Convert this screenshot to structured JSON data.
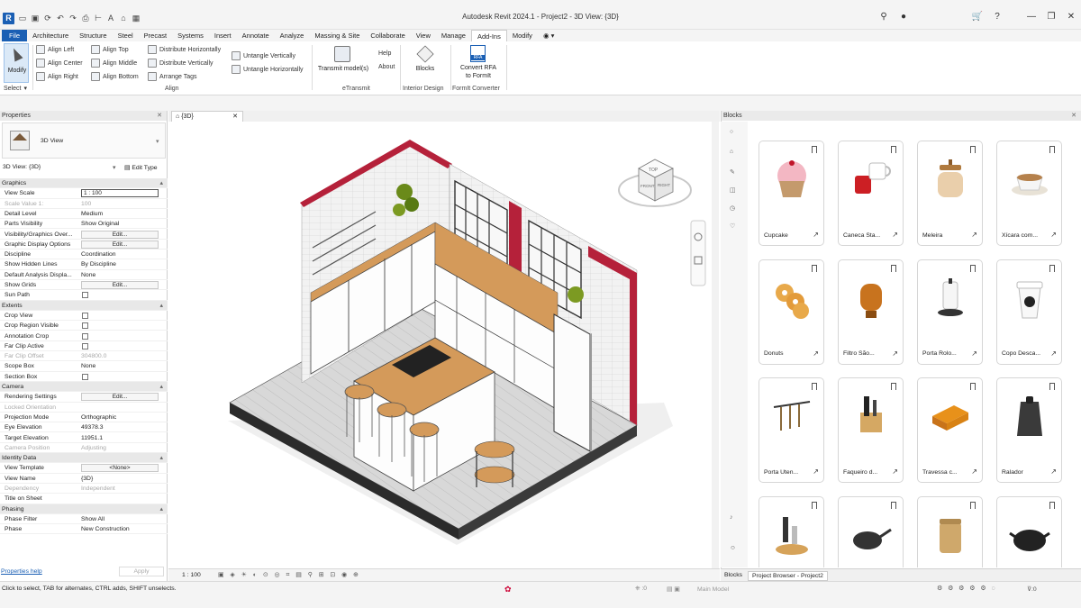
{
  "app": {
    "title": "Autodesk Revit 2024.1 - Project2 - 3D View: {3D}",
    "logo": "R"
  },
  "menu_tabs": [
    "File",
    "Architecture",
    "Structure",
    "Steel",
    "Precast",
    "Systems",
    "Insert",
    "Annotate",
    "Analyze",
    "Massing & Site",
    "Collaborate",
    "View",
    "Manage",
    "Add-Ins",
    "Modify"
  ],
  "ribbon": {
    "modify": "Modify",
    "select": "Select",
    "align": {
      "left": "Align Left",
      "center": "Align Center",
      "right": "Align Right",
      "top": "Align Top",
      "middle": "Align Middle",
      "bottom": "Align Bottom",
      "dist_h": "Distribute Horizontally",
      "dist_v": "Distribute Vertically",
      "arrange": "Arrange Tags",
      "untangle_v": "Untangle Vertically",
      "untangle_h": "Untangle Horizontally",
      "panel": "Align"
    },
    "etransmit": {
      "btn": "Transmit model(s)",
      "panel": "eTransmit"
    },
    "help": "Help",
    "about": "About",
    "blocks": {
      "btn": "Blocks",
      "panel": "Interior Design"
    },
    "formit": {
      "btn1": "Convert RFA",
      "btn2": "to FormIt",
      "panel": "FormIt Converter",
      "badge": "RFA"
    }
  },
  "properties": {
    "title": "Properties",
    "type": "3D View",
    "selector": "3D View: {3D}",
    "edit_type": "Edit Type",
    "help_link": "Properties help",
    "apply": "Apply",
    "rows": [
      {
        "k": "grp",
        "n": "Graphics"
      },
      {
        "k": "box",
        "n": "View Scale",
        "v": "1 : 100"
      },
      {
        "k": "dis",
        "n": "Scale Value    1:",
        "v": "100"
      },
      {
        "k": "txt",
        "n": "Detail Level",
        "v": "Medium"
      },
      {
        "k": "txt",
        "n": "Parts Visibility",
        "v": "Show Original"
      },
      {
        "k": "btn",
        "n": "Visibility/Graphics Over...",
        "v": "Edit..."
      },
      {
        "k": "btn",
        "n": "Graphic Display Options",
        "v": "Edit..."
      },
      {
        "k": "txt",
        "n": "Discipline",
        "v": "Coordination"
      },
      {
        "k": "txt",
        "n": "Show Hidden Lines",
        "v": "By Discipline"
      },
      {
        "k": "txt",
        "n": "Default Analysis Displa...",
        "v": "None"
      },
      {
        "k": "btn",
        "n": "Show Grids",
        "v": "Edit..."
      },
      {
        "k": "cb",
        "n": "Sun Path"
      },
      {
        "k": "grp",
        "n": "Extents"
      },
      {
        "k": "cb",
        "n": "Crop View"
      },
      {
        "k": "cb",
        "n": "Crop Region Visible"
      },
      {
        "k": "cb",
        "n": "Annotation Crop"
      },
      {
        "k": "cb",
        "n": "Far Clip Active"
      },
      {
        "k": "dis",
        "n": "Far Clip Offset",
        "v": "304800.0"
      },
      {
        "k": "txt",
        "n": "Scope Box",
        "v": "None"
      },
      {
        "k": "cb",
        "n": "Section Box"
      },
      {
        "k": "grp",
        "n": "Camera"
      },
      {
        "k": "btn",
        "n": "Rendering Settings",
        "v": "Edit..."
      },
      {
        "k": "dis",
        "n": "Locked Orientation",
        "v": ""
      },
      {
        "k": "txt",
        "n": "Projection Mode",
        "v": "Orthographic"
      },
      {
        "k": "txt",
        "n": "Eye Elevation",
        "v": "49378.3"
      },
      {
        "k": "txt",
        "n": "Target Elevation",
        "v": "11951.1"
      },
      {
        "k": "dis",
        "n": "Camera Position",
        "v": "Adjusting"
      },
      {
        "k": "grp",
        "n": "Identity Data"
      },
      {
        "k": "btn",
        "n": "View Template",
        "v": "<None>"
      },
      {
        "k": "txt",
        "n": "View Name",
        "v": "{3D}"
      },
      {
        "k": "dis",
        "n": "Dependency",
        "v": "Independent"
      },
      {
        "k": "txt",
        "n": "Title on Sheet",
        "v": ""
      },
      {
        "k": "grp",
        "n": "Phasing"
      },
      {
        "k": "txt",
        "n": "Phase Filter",
        "v": "Show All"
      },
      {
        "k": "txt",
        "n": "Phase",
        "v": "New Construction"
      }
    ]
  },
  "view": {
    "tab": "{3D}",
    "scale": "1 : 100",
    "cube_top": "TOP",
    "cube_front": "FRONT",
    "cube_right": "RIGHT"
  },
  "blocks_panel": {
    "title": "Blocks",
    "items": [
      "Cupcake",
      "Caneca Sta...",
      "Meleira",
      "Xícara com...",
      "Donuts",
      "Filtro São...",
      "Porta Rolo...",
      "Copo Desca...",
      "Porta Uten...",
      "Faqueiro d...",
      "Travessa c...",
      "Ralador",
      "",
      "",
      "",
      ""
    ]
  },
  "bottom_tabs": {
    "blocks": "Blocks",
    "browser": "Project Browser - Project2"
  },
  "status": {
    "text": "Click to select, TAB for alternates, CTRL adds, SHIFT unselects.",
    "model": "Main Model",
    "zero1": ":0",
    "zero2": ":0"
  },
  "colors": {
    "accent": "#1a5fb4",
    "wall_red": "#b5213a",
    "wood": "#d49a5a"
  }
}
